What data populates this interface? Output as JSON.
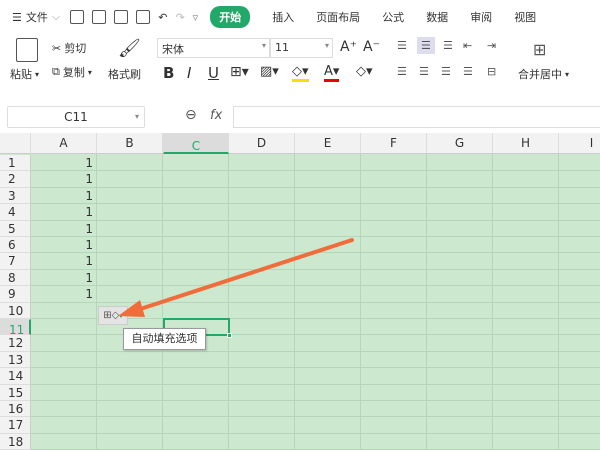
{
  "menubar": {
    "menu_icon": "hamburger-icon",
    "file": "文件",
    "tabs": [
      "开始",
      "插入",
      "页面布局",
      "公式",
      "数据",
      "审阅",
      "视图"
    ]
  },
  "ribbon": {
    "paste": "粘贴",
    "cut": "剪切",
    "copy": "复制",
    "format_painter": "格式刷",
    "font": "宋体",
    "font_size": "11",
    "bold": "B",
    "italic": "I",
    "underline": "U",
    "merge_center": "合并居中"
  },
  "formula_bar": {
    "name_box": "C11",
    "fx": "fx",
    "value": ""
  },
  "grid": {
    "columns": [
      "A",
      "B",
      "C",
      "D",
      "E",
      "F",
      "G",
      "H",
      "I"
    ],
    "rows": [
      "1",
      "2",
      "3",
      "4",
      "5",
      "6",
      "7",
      "8",
      "9",
      "10",
      "11",
      "12",
      "13",
      "14",
      "15",
      "16",
      "17",
      "18"
    ],
    "selected_cell": "C11",
    "col_a_values": [
      "1",
      "1",
      "1",
      "1",
      "1",
      "1",
      "1",
      "1",
      "1"
    ]
  },
  "autofill": {
    "tooltip": "自动填充选项"
  },
  "colors": {
    "accent": "#22a96a",
    "sheet_bg": "#cce8cf",
    "arrow": "#f26b3a"
  }
}
